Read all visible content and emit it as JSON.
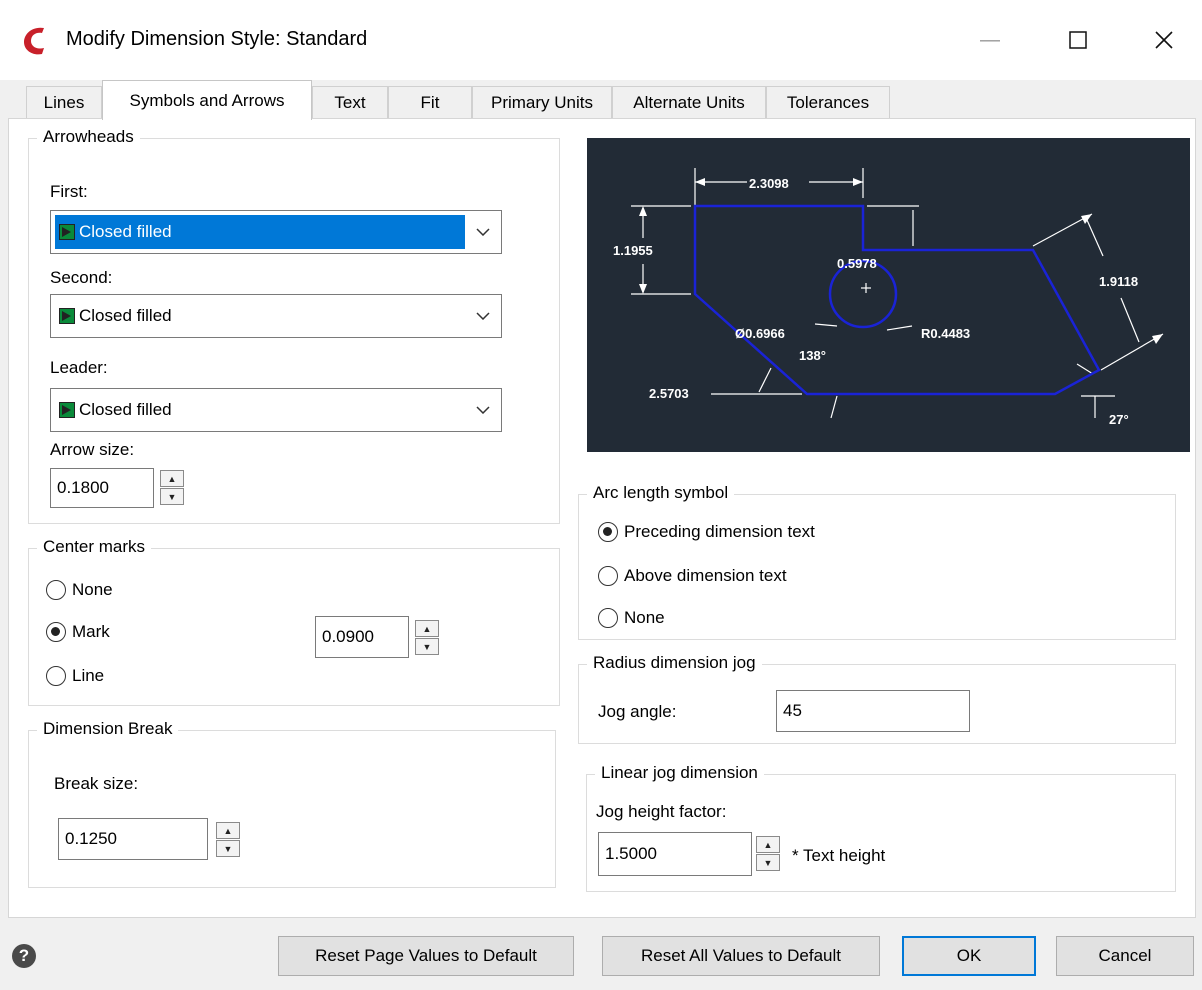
{
  "window": {
    "title": "Modify Dimension Style: Standard",
    "minimize": "—",
    "maximize": "☐",
    "close": "✕"
  },
  "tabs": [
    {
      "label": "Lines"
    },
    {
      "label": "Symbols and Arrows"
    },
    {
      "label": "Text"
    },
    {
      "label": "Fit"
    },
    {
      "label": "Primary Units"
    },
    {
      "label": "Alternate Units"
    },
    {
      "label": "Tolerances"
    }
  ],
  "arrowheads": {
    "group_label": "Arrowheads",
    "first_label": "First:",
    "first_value": "Closed filled",
    "second_label": "Second:",
    "second_value": "Closed filled",
    "leader_label": "Leader:",
    "leader_value": "Closed filled",
    "arrow_size_label": "Arrow size:",
    "arrow_size_value": "0.1800"
  },
  "center_marks": {
    "group_label": "Center marks",
    "none_label": "None",
    "mark_label": "Mark",
    "line_label": "Line",
    "selected": "Mark",
    "size_value": "0.0900"
  },
  "dimension_break": {
    "group_label": "Dimension Break",
    "break_size_label": "Break size:",
    "break_size_value": "0.1250"
  },
  "preview": {
    "labels": [
      "2.3098",
      "1.1955",
      "0.5978",
      "1.9118",
      "Ø0.6966",
      "R0.4483",
      "138°",
      "2.5703",
      "27°"
    ]
  },
  "arc_length": {
    "group_label": "Arc length symbol",
    "preceding_label": "Preceding dimension text",
    "above_label": "Above dimension text",
    "none_label": "None",
    "selected": "Preceding dimension text"
  },
  "radius_jog": {
    "group_label": "Radius dimension jog",
    "jog_angle_label": "Jog angle:",
    "jog_angle_value": "45"
  },
  "linear_jog": {
    "group_label": "Linear jog dimension",
    "height_factor_label": "Jog height factor:",
    "height_factor_value": "1.5000",
    "suffix": "* Text height"
  },
  "buttons": {
    "reset_page": "Reset Page Values to Default",
    "reset_all": "Reset All Values to Default",
    "ok": "OK",
    "cancel": "Cancel"
  },
  "colors": {
    "accent": "#0078d7",
    "preview_bg": "#222b36",
    "preview_shape": "#1a23d6",
    "app_icon": "#c8202a"
  }
}
